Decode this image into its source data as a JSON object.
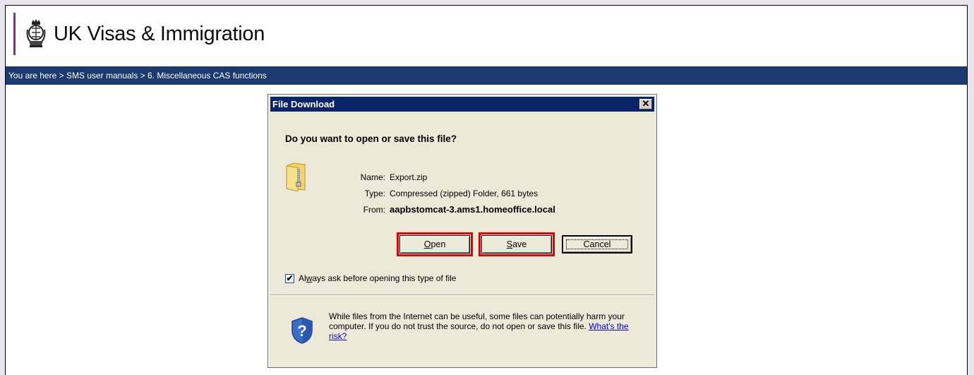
{
  "header": {
    "title": "UK Visas & Immigration"
  },
  "breadcrumb": {
    "text": "You are here > SMS user manuals >  6. Miscellaneous CAS functions"
  },
  "dialog": {
    "title": "File Download",
    "close_glyph": "✕",
    "question": "Do you want to open or save this file?",
    "file": {
      "name_label": "Name:",
      "name": "Export.zip",
      "type_label": "Type:",
      "type": "Compressed (zipped) Folder, 661 bytes",
      "from_label": "From:",
      "from": "aapbstomcat-3.ams1.homeoffice.local"
    },
    "buttons": {
      "open_ul": "O",
      "open_rest": "pen",
      "save_ul": "S",
      "save_rest": "ave",
      "cancel": "Cancel"
    },
    "checkbox": {
      "checked": true,
      "label_pre": "Al",
      "label_ul": "w",
      "label_post": "ays ask before opening this type of file"
    },
    "warning": {
      "text": "While files from the Internet can be useful, some files can potentially harm your computer. If you do not trust the source, do not open or save this file.",
      "link": "What's the risk?"
    }
  },
  "colors": {
    "nav_bg": "#1d3a6e",
    "title_bar": "#0a246a",
    "highlight": "#e00000",
    "brand_stripe": "#8b2a8f"
  }
}
